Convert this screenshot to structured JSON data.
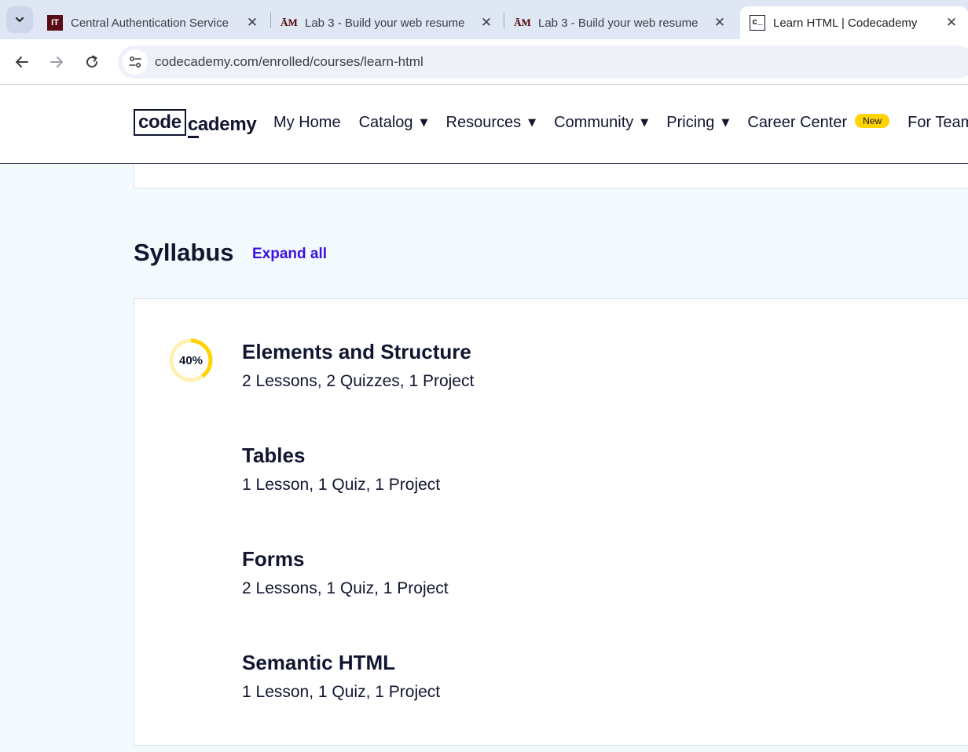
{
  "browser": {
    "tabs": [
      {
        "title": "Central Authentication Service",
        "favicon_text": "IT",
        "icon": "it-favicon-icon",
        "active": false
      },
      {
        "title": "Lab 3 - Build your web resume",
        "favicon_text": "ĀM",
        "icon": "tamu-favicon-icon",
        "active": false
      },
      {
        "title": "Lab 3 - Build your web resume",
        "favicon_text": "ĀM",
        "icon": "tamu-favicon-icon",
        "active": false
      },
      {
        "title": "Learn HTML | Codecademy",
        "favicon_text": "c_",
        "icon": "codecademy-favicon-icon",
        "active": true
      }
    ],
    "url": "codecademy.com/enrolled/courses/learn-html"
  },
  "header": {
    "logo_code": "code",
    "logo_cademy": "cademy",
    "nav": {
      "my_home": "My Home",
      "catalog": "Catalog",
      "resources": "Resources",
      "community": "Community",
      "pricing": "Pricing",
      "career_center": "Career Center",
      "new_badge": "New",
      "for_teams": "For Teams"
    }
  },
  "syllabus": {
    "title": "Syllabus",
    "expand_all": "Expand all",
    "modules": [
      {
        "title": "Elements and Structure",
        "meta": "2 Lessons, 2 Quizzes, 1 Project",
        "progress_label": "40%",
        "progress": 0.4
      },
      {
        "title": "Tables",
        "meta": "1 Lesson, 1 Quiz, 1 Project"
      },
      {
        "title": "Forms",
        "meta": "2 Lessons, 1 Quiz, 1 Project"
      },
      {
        "title": "Semantic HTML",
        "meta": "1 Lesson, 1 Quiz, 1 Project"
      }
    ]
  },
  "colors": {
    "page_bg": "#f3fafd",
    "navy": "#10162f",
    "link_purple": "#3a10e5",
    "progress_yellow": "#ffd300",
    "progress_track": "#fff0b3"
  }
}
